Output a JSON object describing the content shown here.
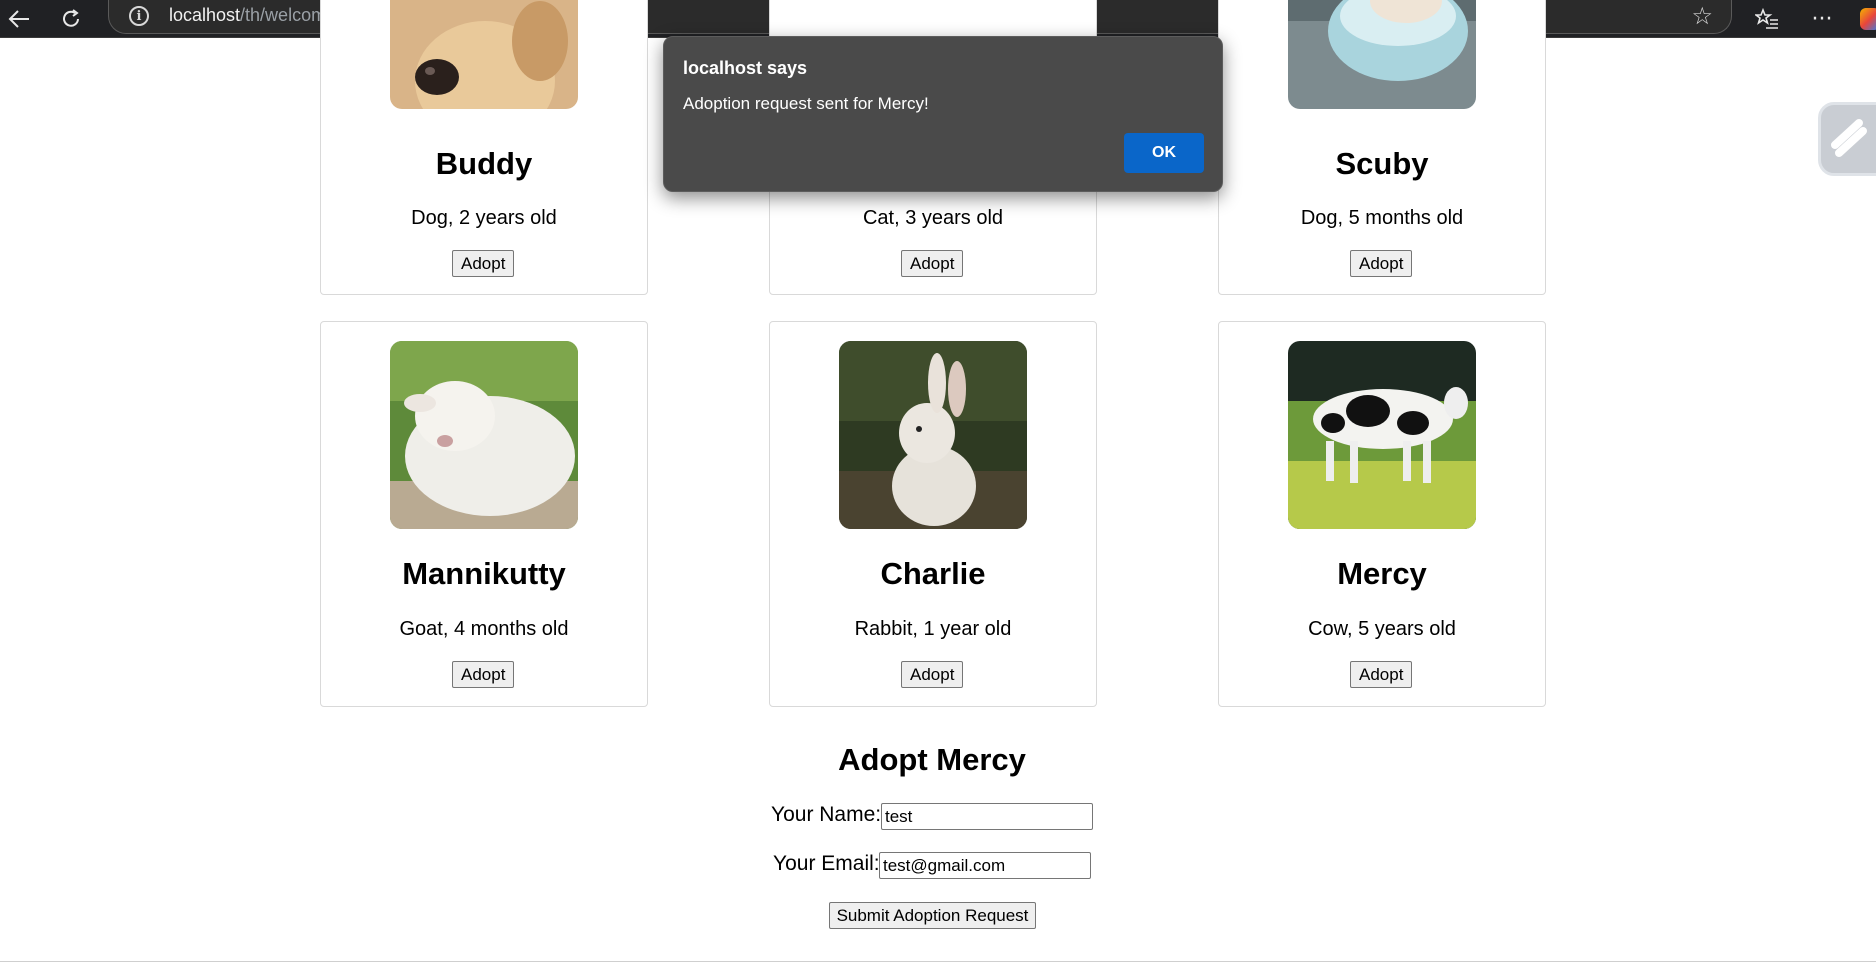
{
  "browser": {
    "url_host": "localhost",
    "url_path": "/th/welcome.php",
    "icons": [
      "back-arrow-icon",
      "refresh-icon",
      "info-icon",
      "favorite-star-icon",
      "favorites-list-icon",
      "more-menu-icon"
    ]
  },
  "pets": [
    {
      "name": "Buddy",
      "info": "Dog, 2 years old",
      "button": "Adopt"
    },
    {
      "name": "",
      "info": "Cat, 3 years old",
      "button": "Adopt"
    },
    {
      "name": "Scuby",
      "info": "Dog, 5 months old",
      "button": "Adopt"
    },
    {
      "name": "Mannikutty",
      "info": "Goat, 4 months old",
      "button": "Adopt"
    },
    {
      "name": "Charlie",
      "info": "Rabbit, 1 year old",
      "button": "Adopt"
    },
    {
      "name": "Mercy",
      "info": "Cow, 5 years old",
      "button": "Adopt"
    }
  ],
  "form": {
    "title": "Adopt Mercy",
    "name_label": "Your Name:",
    "name_value": "test",
    "email_label": "Your Email:",
    "email_value": "test@gmail.com",
    "submit_label": "Submit Adoption Request"
  },
  "dialog": {
    "title": "localhost says",
    "message": "Adoption request sent for Mercy!",
    "ok_label": "OK",
    "button_color": "#0a66c9"
  }
}
